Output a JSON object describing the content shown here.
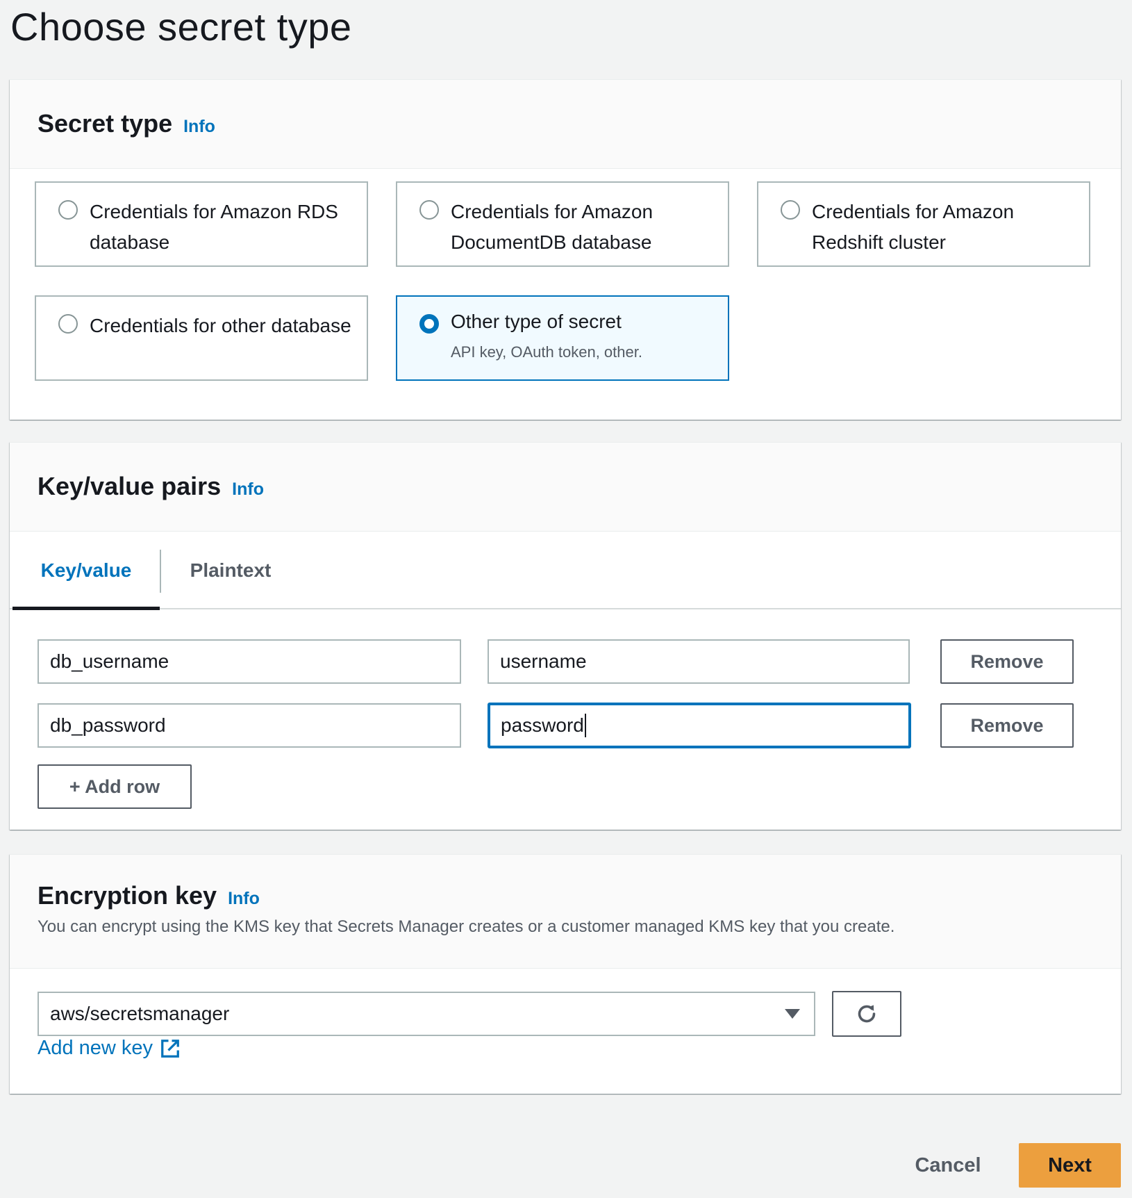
{
  "page": {
    "title": "Choose secret type"
  },
  "secret_type": {
    "heading": "Secret type",
    "info": "Info",
    "options": [
      {
        "label": "Credentials for Amazon RDS database",
        "selected": false
      },
      {
        "label": "Credentials for Amazon DocumentDB database",
        "selected": false
      },
      {
        "label": "Credentials for Amazon Redshift cluster",
        "selected": false
      },
      {
        "label": "Credentials for other database",
        "selected": false
      },
      {
        "label": "Other type of secret",
        "description": "API key, OAuth token, other.",
        "selected": true
      }
    ]
  },
  "kv": {
    "heading": "Key/value pairs",
    "info": "Info",
    "tabs": [
      {
        "label": "Key/value",
        "active": true
      },
      {
        "label": "Plaintext",
        "active": false
      }
    ],
    "rows": [
      {
        "key": "db_username",
        "value": "username",
        "remove_label": "Remove"
      },
      {
        "key": "db_password",
        "value": "password",
        "remove_label": "Remove"
      }
    ],
    "add_row_label": "+ Add row"
  },
  "encryption": {
    "heading": "Encryption key",
    "info": "Info",
    "description": "You can encrypt using the KMS key that Secrets Manager creates or a customer managed KMS key that you create.",
    "selected_key": "aws/secretsmanager",
    "add_new_key_label": "Add new key"
  },
  "footer": {
    "cancel_label": "Cancel",
    "next_label": "Next"
  },
  "colors": {
    "accent": "#0073bb",
    "primary_button": "#ec9f3e",
    "background": "#f2f3f3"
  },
  "icons": {
    "refresh": "refresh-icon",
    "external_link": "external-link-icon",
    "dropdown": "caret-down-icon"
  }
}
